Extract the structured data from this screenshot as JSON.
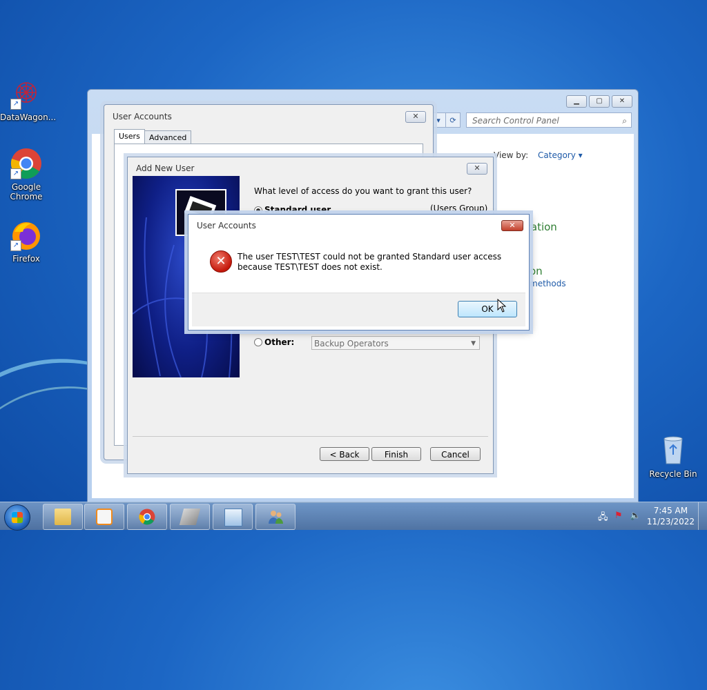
{
  "desktop": {
    "icons": [
      {
        "label": "DataWagon..."
      },
      {
        "label": "Google Chrome"
      },
      {
        "label": "Firefox"
      },
      {
        "label": "Recycle Bin"
      }
    ]
  },
  "control_panel": {
    "search_placeholder": "Search Control Panel",
    "view_by_label": "View by:",
    "view_by_value": "Category",
    "fragment_1": "zation",
    "fragment_2": "on",
    "fragment_3": "methods"
  },
  "user_accounts": {
    "title": "User Accounts",
    "tabs": [
      "Users",
      "Advanced"
    ]
  },
  "add_new_user": {
    "title": "Add New User",
    "question": "What level of access do you want to grant this user?",
    "standard_label": "Standard user",
    "standard_group": "(Users Group)",
    "other_label": "Other:",
    "other_value": "Backup Operators",
    "buttons": {
      "back": "< Back",
      "finish": "Finish",
      "cancel": "Cancel"
    }
  },
  "error_dialog": {
    "title": "User Accounts",
    "message": "The user TEST\\TEST could not be granted Standard user access because TEST\\TEST does not exist.",
    "ok_label": "OK"
  },
  "taskbar": {
    "time": "7:45 AM",
    "date": "11/23/2022",
    "pinned": [
      "explorer",
      "media-player",
      "chrome",
      "tools",
      "control-panel",
      "users"
    ]
  }
}
